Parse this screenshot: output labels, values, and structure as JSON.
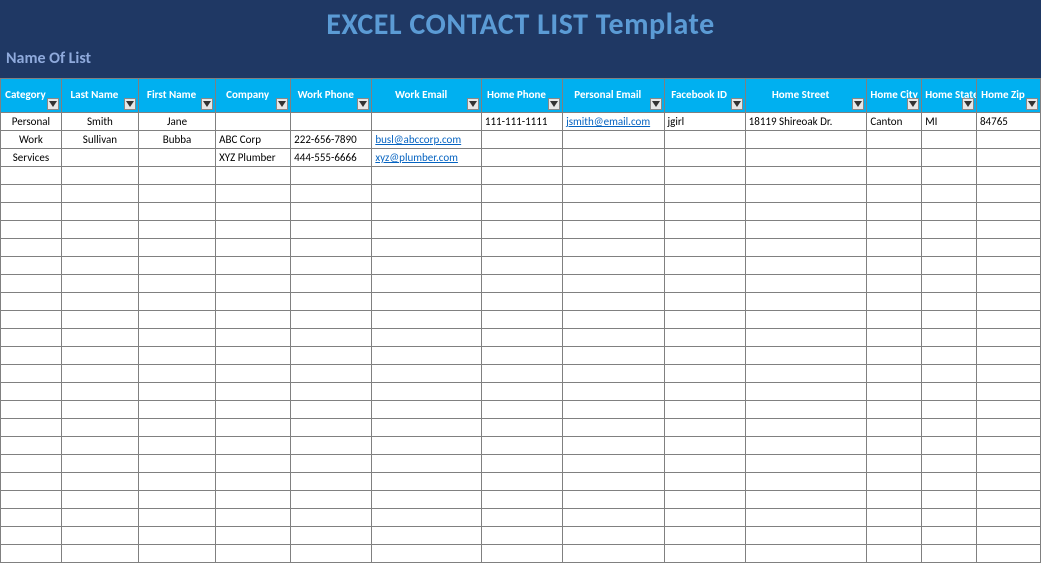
{
  "banner": {
    "title": "EXCEL CONTACT LIST Template",
    "subtitle": "Name Of List"
  },
  "columns": [
    {
      "label": "Category"
    },
    {
      "label": "Last Name"
    },
    {
      "label": "First Name"
    },
    {
      "label": "Company"
    },
    {
      "label": "Work Phone"
    },
    {
      "label": "Work Email"
    },
    {
      "label": "Home Phone"
    },
    {
      "label": "Personal Email"
    },
    {
      "label": "Facebook ID"
    },
    {
      "label": "Home Street"
    },
    {
      "label": "Home City"
    },
    {
      "label": "Home State"
    },
    {
      "label": "Home Zip"
    }
  ],
  "rows": [
    {
      "cells": [
        "Personal",
        "Smith",
        "Jane",
        "",
        "",
        "",
        "111-111-1111",
        "jsmith@email.com",
        "jgirl",
        "18119 Shireoak Dr.",
        "Canton",
        "MI",
        "84765"
      ],
      "links": [
        7
      ]
    },
    {
      "cells": [
        "Work",
        "Sullivan",
        "Bubba",
        "ABC Corp",
        "222-656-7890",
        "busl@abccorp.com",
        "",
        "",
        "",
        "",
        "",
        "",
        ""
      ],
      "links": [
        5
      ]
    },
    {
      "cells": [
        "Services",
        "",
        "",
        "XYZ Plumber",
        "444-555-6666",
        "xyz@plumber.com",
        "",
        "",
        "",
        "",
        "",
        "",
        ""
      ],
      "links": [
        5
      ]
    }
  ],
  "emptyRows": 22
}
